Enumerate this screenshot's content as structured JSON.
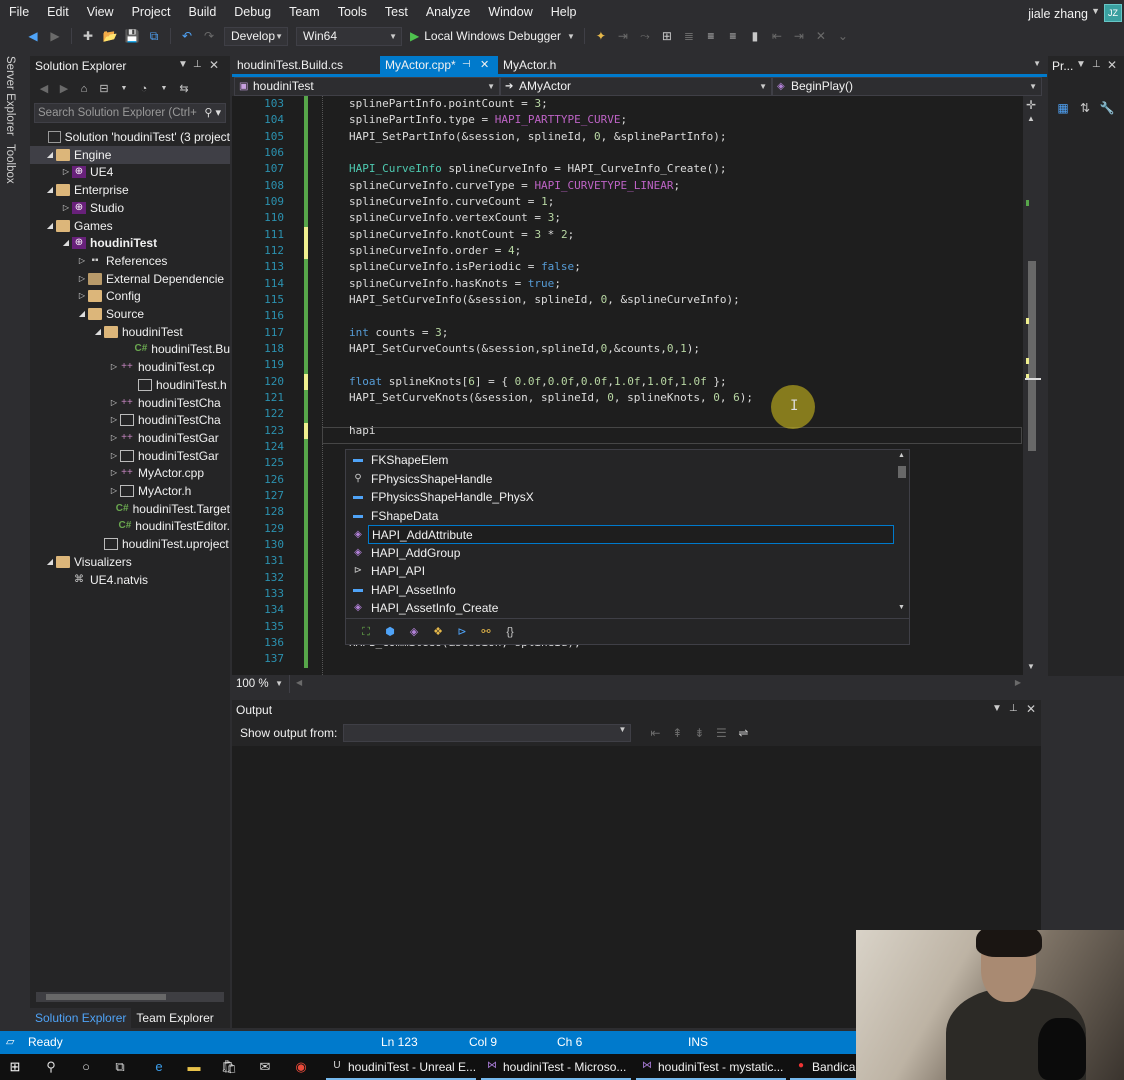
{
  "menu": [
    "File",
    "Edit",
    "View",
    "Project",
    "Build",
    "Debug",
    "Team",
    "Tools",
    "Test",
    "Analyze",
    "Window",
    "Help"
  ],
  "user": {
    "name": "jiale zhang",
    "initials": "JZ"
  },
  "toolbar": {
    "config": "Develop",
    "platform": "Win64",
    "debugger": "Local Windows Debugger"
  },
  "sidebar_tabs": [
    "Server Explorer",
    "Toolbox"
  ],
  "solution_explorer": {
    "title": "Solution Explorer",
    "search_placeholder": "Search Solution Explorer (Ctrl+",
    "items": [
      {
        "label": "Solution 'houdiniTest' (3 project",
        "icon": "solution-icon",
        "expand": "",
        "bold": false
      },
      {
        "label": "Engine",
        "icon": "folder-icon",
        "expand": "open",
        "bold": false,
        "selected": true
      },
      {
        "label": "UE4",
        "icon": "project-icon",
        "expand": "closed",
        "bold": false
      },
      {
        "label": "Enterprise",
        "icon": "folder-icon",
        "expand": "open",
        "bold": false
      },
      {
        "label": "Studio",
        "icon": "project-icon",
        "expand": "closed",
        "bold": false
      },
      {
        "label": "Games",
        "icon": "folder-icon",
        "expand": "open",
        "bold": false
      },
      {
        "label": "houdiniTest",
        "icon": "project-icon",
        "expand": "open",
        "bold": true
      },
      {
        "label": "References",
        "icon": "references-icon",
        "expand": "closed",
        "bold": false
      },
      {
        "label": "External Dependencie",
        "icon": "external-icon",
        "expand": "closed",
        "bold": false
      },
      {
        "label": "Config",
        "icon": "folder-icon",
        "expand": "closed",
        "bold": false
      },
      {
        "label": "Source",
        "icon": "folder-icon",
        "expand": "open",
        "bold": false
      },
      {
        "label": "houdiniTest",
        "icon": "folder-icon",
        "expand": "open",
        "bold": false
      },
      {
        "label": "houdiniTest.Bu",
        "icon": "cs-icon",
        "expand": "",
        "bold": false
      },
      {
        "label": "houdiniTest.cp",
        "icon": "cpp-icon",
        "expand": "closed",
        "bold": false
      },
      {
        "label": "houdiniTest.h",
        "icon": "header-icon",
        "expand": "",
        "bold": false
      },
      {
        "label": "houdiniTestCha",
        "icon": "cpp-icon",
        "expand": "closed",
        "bold": false
      },
      {
        "label": "houdiniTestCha",
        "icon": "header-icon",
        "expand": "closed",
        "bold": false
      },
      {
        "label": "houdiniTestGar",
        "icon": "cpp-icon",
        "expand": "closed",
        "bold": false
      },
      {
        "label": "houdiniTestGar",
        "icon": "header-icon",
        "expand": "closed",
        "bold": false
      },
      {
        "label": "MyActor.cpp",
        "icon": "cpp-icon",
        "expand": "closed",
        "bold": false
      },
      {
        "label": "MyActor.h",
        "icon": "header-icon",
        "expand": "closed",
        "bold": false
      },
      {
        "label": "houdiniTest.Target",
        "icon": "cs-icon",
        "expand": "",
        "bold": false
      },
      {
        "label": "houdiniTestEditor.",
        "icon": "cs-icon",
        "expand": "",
        "bold": false
      },
      {
        "label": "houdiniTest.uproject",
        "icon": "header-icon",
        "expand": "",
        "bold": false
      },
      {
        "label": "Visualizers",
        "icon": "folder-icon",
        "expand": "open",
        "bold": false
      },
      {
        "label": "UE4.natvis",
        "icon": "natvis-icon",
        "expand": "",
        "bold": false
      }
    ],
    "bottom_tabs": [
      "Solution Explorer",
      "Team Explorer"
    ]
  },
  "editor_tabs": [
    {
      "label": "houdiniTest.Build.cs",
      "active": false
    },
    {
      "label": "MyActor.cpp*",
      "active": true
    },
    {
      "label": "MyActor.h",
      "active": false
    }
  ],
  "navbar": {
    "project": "houdiniTest",
    "class": "AMyActor",
    "method": "BeginPlay()"
  },
  "code_lines": [
    {
      "n": "103",
      "chg": "g",
      "html": "splinePartInfo.pointCount = <span class=\"cn\">3</span>;"
    },
    {
      "n": "104",
      "chg": "g",
      "html": "splinePartInfo.type = <span class=\"mc\">HAPI_PARTTYPE_CURVE</span>;"
    },
    {
      "n": "105",
      "chg": "g",
      "html": "HAPI_SetPartInfo(&amp;session, splineId, <span class=\"cn\">0</span>, &amp;splinePartInfo);"
    },
    {
      "n": "106",
      "chg": "g",
      "html": ""
    },
    {
      "n": "107",
      "chg": "g",
      "html": "<span class=\"ty\">HAPI_CurveInfo</span> splineCurveInfo = HAPI_CurveInfo_Create();"
    },
    {
      "n": "108",
      "chg": "g",
      "html": "splineCurveInfo.curveType = <span class=\"mc\">HAPI_CURVETYPE_LINEAR</span>;"
    },
    {
      "n": "109",
      "chg": "g",
      "html": "splineCurveInfo.curveCount = <span class=\"cn\">1</span>;"
    },
    {
      "n": "110",
      "chg": "g",
      "html": "splineCurveInfo.vertexCount = <span class=\"cn\">3</span>;"
    },
    {
      "n": "111",
      "chg": "y",
      "html": "splineCurveInfo.knotCount = <span class=\"cn\">3</span> * <span class=\"cn\">2</span>;"
    },
    {
      "n": "112",
      "chg": "y",
      "html": "splineCurveInfo.order = <span class=\"cn\">4</span>;"
    },
    {
      "n": "113",
      "chg": "g",
      "html": "splineCurveInfo.isPeriodic = <span class=\"kw\">false</span>;"
    },
    {
      "n": "114",
      "chg": "g",
      "html": "splineCurveInfo.hasKnots = <span class=\"kw\">true</span>;"
    },
    {
      "n": "115",
      "chg": "g",
      "html": "HAPI_SetCurveInfo(&amp;session, splineId, <span class=\"cn\">0</span>, &amp;splineCurveInfo);"
    },
    {
      "n": "116",
      "chg": "g",
      "html": ""
    },
    {
      "n": "117",
      "chg": "g",
      "html": "<span class=\"kw\">int</span> counts = <span class=\"cn\">3</span>;"
    },
    {
      "n": "118",
      "chg": "g",
      "html": "HAPI_SetCurveCounts(&amp;session,splineId,<span class=\"cn\">0</span>,&amp;counts,<span class=\"cn\">0</span>,<span class=\"cn\">1</span>);"
    },
    {
      "n": "119",
      "chg": "g",
      "html": ""
    },
    {
      "n": "120",
      "chg": "y",
      "html": "<span class=\"kw\">float</span> splineKnots[<span class=\"cn\">6</span>] = { <span class=\"cn\">0.0f</span>,<span class=\"cn\">0.0f</span>,<span class=\"cn\">0.0f</span>,<span class=\"cn\">1.0f</span>,<span class=\"cn\">1.0f</span>,<span class=\"cn\">1.0f</span> };"
    },
    {
      "n": "121",
      "chg": "g",
      "html": "HAPI_SetCurveKnots(&amp;session, splineId, <span class=\"cn\">0</span>, splineKnots, <span class=\"cn\">0</span>, <span class=\"cn\">6</span>);"
    },
    {
      "n": "122",
      "chg": "g",
      "html": ""
    },
    {
      "n": "123",
      "chg": "y",
      "html": "hapi"
    },
    {
      "n": "124",
      "chg": "g",
      "html": ""
    },
    {
      "n": "125",
      "chg": "g",
      "html": ""
    },
    {
      "n": "126",
      "chg": "g",
      "html": ""
    },
    {
      "n": "127",
      "chg": "g",
      "html": ""
    },
    {
      "n": "128",
      "chg": "g",
      "html": ""
    },
    {
      "n": "129",
      "chg": "g",
      "html": ""
    },
    {
      "n": "130",
      "chg": "g",
      "html": ""
    },
    {
      "n": "131",
      "chg": "g",
      "html": ""
    },
    {
      "n": "132",
      "chg": "g",
      "html": ""
    },
    {
      "n": "133",
      "chg": "g",
      "html": ""
    },
    {
      "n": "134",
      "chg": "g",
      "html": "                                                                                  );"
    },
    {
      "n": "135",
      "chg": "g",
      "html": ""
    },
    {
      "n": "136",
      "chg": "g",
      "html": "HAPI_CommitGeo(&amp;session, splineId);"
    },
    {
      "n": "137",
      "chg": "g",
      "html": ""
    }
  ],
  "zoom": "100 %",
  "autocomplete": {
    "items": [
      {
        "label": "FKShapeElem",
        "icon": "struct-icon",
        "color": "#4fa3f7",
        "glyph": "▬"
      },
      {
        "label": "FPhysicsShapeHandle",
        "icon": "typedef-icon",
        "color": "#c8c8c8",
        "glyph": "⚲"
      },
      {
        "label": "FPhysicsShapeHandle_PhysX",
        "icon": "struct-icon",
        "color": "#4fa3f7",
        "glyph": "▬"
      },
      {
        "label": "FShapeData",
        "icon": "struct-icon",
        "color": "#4fa3f7",
        "glyph": "▬"
      },
      {
        "label": "HAPI_AddAttribute",
        "icon": "function-icon",
        "color": "#b180d7",
        "glyph": "◈"
      },
      {
        "label": "HAPI_AddGroup",
        "icon": "function-icon",
        "color": "#b180d7",
        "glyph": "◈"
      },
      {
        "label": "HAPI_API",
        "icon": "macro-icon",
        "color": "#c8c8c8",
        "glyph": "⊳"
      },
      {
        "label": "HAPI_AssetInfo",
        "icon": "struct-icon",
        "color": "#4fa3f7",
        "glyph": "▬"
      },
      {
        "label": "HAPI_AssetInfo_Create",
        "icon": "function-icon",
        "color": "#b180d7",
        "glyph": "◈"
      }
    ],
    "selected_index": 4
  },
  "right_panel": {
    "title": "Pr..."
  },
  "output": {
    "title": "Output",
    "show_from_label": "Show output from:"
  },
  "status": {
    "ready": "Ready",
    "ln": "Ln 123",
    "col": "Col 9",
    "ch": "Ch 6",
    "ins": "INS"
  },
  "taskbar": {
    "items": [
      {
        "label": "houdiniTest - Unreal E...",
        "icon": "unreal-icon"
      },
      {
        "label": "houdiniTest - Microso...",
        "icon": "vs-icon"
      },
      {
        "label": "houdiniTest - mystatic...",
        "icon": "vs-icon"
      },
      {
        "label": "Bandicam",
        "icon": "record-icon"
      }
    ]
  },
  "colors": {
    "accent": "#007acc",
    "bg": "#2d2d30",
    "editor_bg": "#1e1e1e"
  }
}
